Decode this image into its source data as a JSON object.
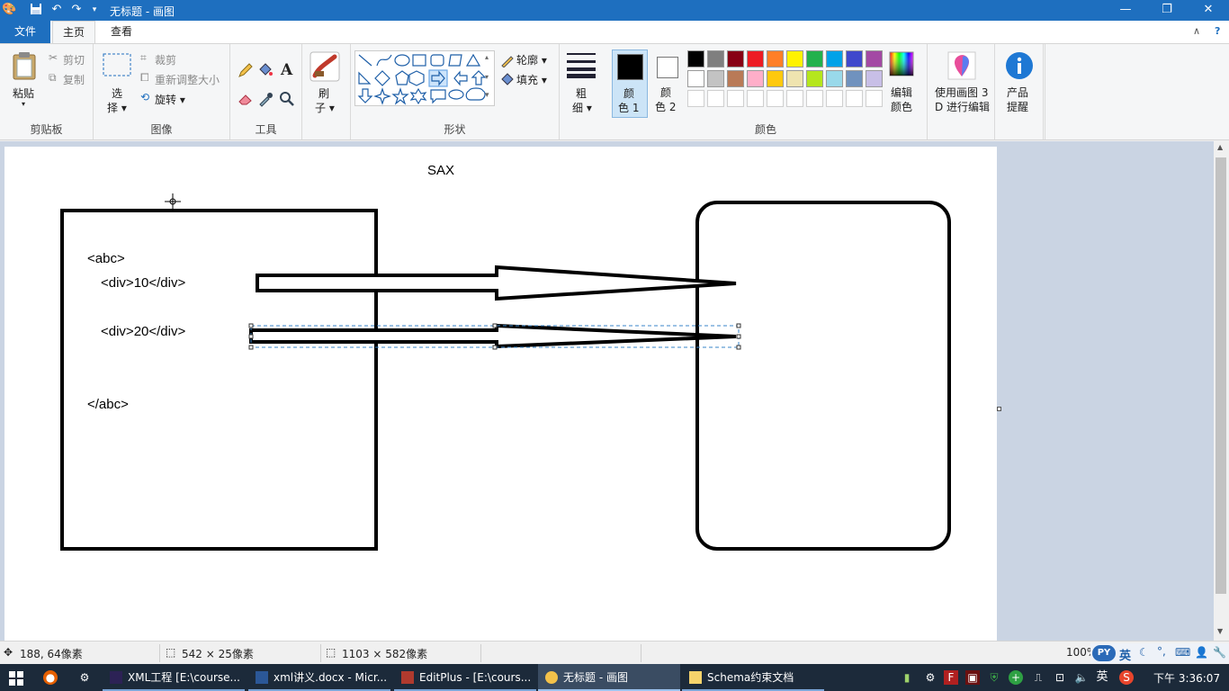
{
  "window": {
    "title": "无标题 - 画图",
    "minimize": "—",
    "maximize": "❐",
    "close": "✕"
  },
  "tabs": {
    "file": "文件",
    "home": "主页",
    "view": "查看"
  },
  "ribbon": {
    "clipboard": {
      "paste": "粘贴",
      "cut": "剪切",
      "copy": "复制",
      "label": "剪贴板"
    },
    "image": {
      "select_top": "选",
      "select_bottom": "择 ▾",
      "crop": "裁剪",
      "resize": "重新调整大小",
      "rotate": "旋转 ▾",
      "label": "图像"
    },
    "tools": {
      "text_tool": "A",
      "label": "工具"
    },
    "brushes": {
      "label_top": "刷",
      "label_bottom": "子 ▾"
    },
    "shapes": {
      "outline": "轮廓 ▾",
      "fill": "填充 ▾",
      "label": "形状"
    },
    "size": {
      "top": "粗",
      "bottom": "细 ▾"
    },
    "color1": {
      "top": "颜",
      "bottom": "色 1"
    },
    "color2": {
      "top": "颜",
      "bottom": "色 2"
    },
    "edit_colors": {
      "top": "编辑",
      "bottom": "颜色"
    },
    "paint3d": {
      "top": "使用画图 3",
      "bottom": "D 进行编辑"
    },
    "product": {
      "top": "产品",
      "bottom": "提醒"
    },
    "colors_label": "颜色",
    "palette_row1": [
      "#000000",
      "#7f7f7f",
      "#880015",
      "#ed1c24",
      "#ff7f27",
      "#fff200",
      "#22b14c",
      "#00a2e8",
      "#3f48cc",
      "#a349a4"
    ],
    "palette_row2": [
      "#ffffff",
      "#c3c3c3",
      "#b97a57",
      "#ffaec9",
      "#ffc90e",
      "#efe4b0",
      "#b5e61d",
      "#99d9ea",
      "#7092be",
      "#c8bfe7"
    ],
    "palette_row3": [
      "#ffffff",
      "#ffffff",
      "#ffffff",
      "#ffffff",
      "#ffffff",
      "#ffffff",
      "#ffffff",
      "#ffffff",
      "#ffffff",
      "#ffffff"
    ]
  },
  "canvas": {
    "title": "SAX",
    "abc_open": "<abc>",
    "div1": "<div>10</div>",
    "div2": "<div>20</div>",
    "abc_close": "</abc>"
  },
  "status": {
    "cursor_pos": "188, 64像素",
    "selection_size": "542 × 25像素",
    "canvas_size": "1103 × 582像素",
    "zoom": "100%"
  },
  "taskbar": {
    "items": [
      "XML工程 [E:\\course...",
      "xml讲义.docx - Micr...",
      "EditPlus - [E:\\cours...",
      "无标题 - 画图",
      "Schema约束文档"
    ],
    "ime": "英",
    "ime2": "英",
    "clock": "下午 3:36:07"
  }
}
